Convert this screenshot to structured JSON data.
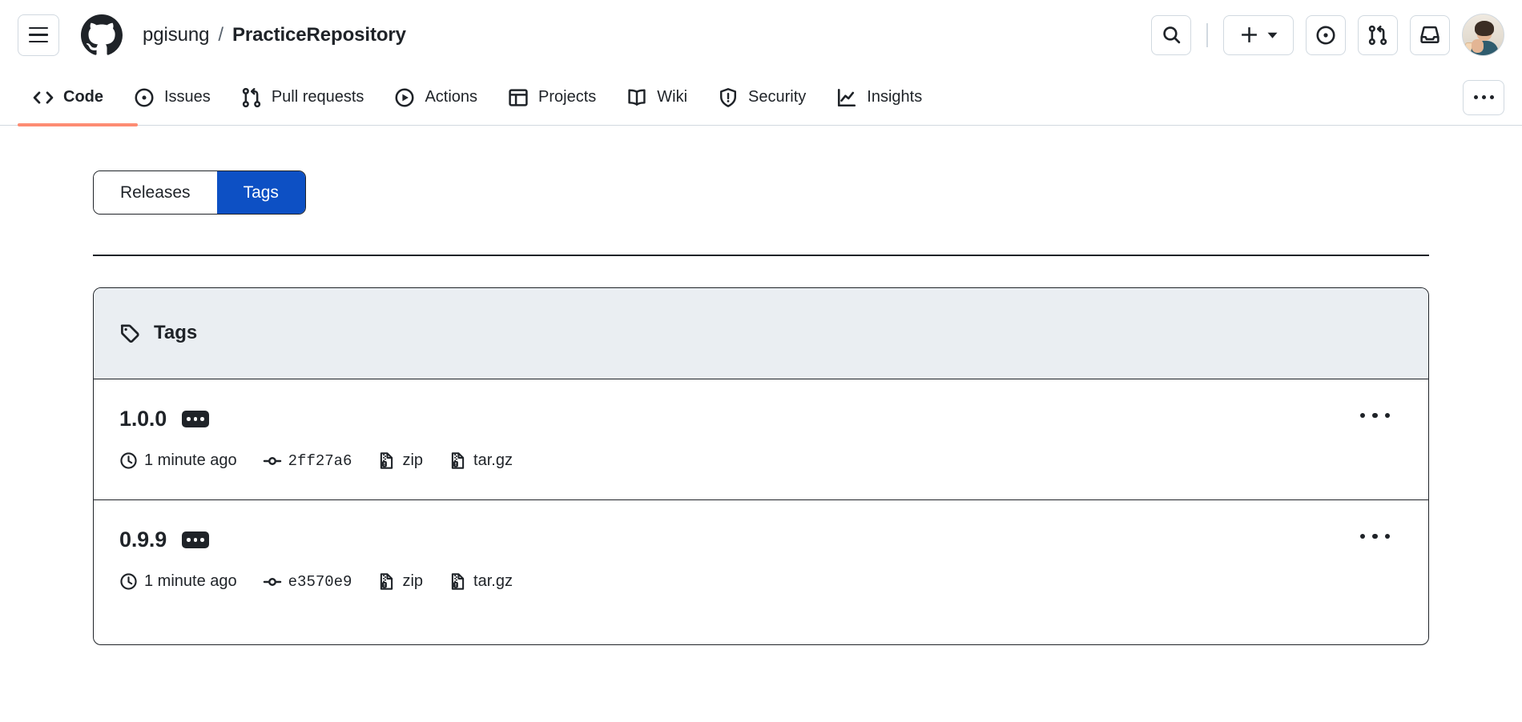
{
  "header": {
    "menu_button": "menu-icon",
    "logo": "github-logo",
    "repo_owner": "pgisung",
    "separator": "/",
    "repo_name": "PracticeRepository",
    "actions": [
      {
        "name": "search-button",
        "icon": "search-icon"
      },
      {
        "name": "create-new-button",
        "icon": "plus-icon",
        "caret": "chevron-down-icon"
      },
      {
        "name": "issues-button",
        "icon": "issue-opened-icon"
      },
      {
        "name": "pull-requests-button",
        "icon": "git-pull-request-icon"
      },
      {
        "name": "notifications-button",
        "icon": "inbox-icon"
      },
      {
        "name": "user-avatar",
        "icon": "avatar"
      }
    ]
  },
  "repo_nav": {
    "tabs": [
      {
        "label": "Code",
        "icon": "code-icon",
        "active": true
      },
      {
        "label": "Issues",
        "icon": "issue-opened-icon",
        "active": false
      },
      {
        "label": "Pull requests",
        "icon": "git-pull-request-icon",
        "active": false
      },
      {
        "label": "Actions",
        "icon": "play-icon",
        "active": false
      },
      {
        "label": "Projects",
        "icon": "table-icon",
        "active": false
      },
      {
        "label": "Wiki",
        "icon": "book-icon",
        "active": false
      },
      {
        "label": "Security",
        "icon": "shield-icon",
        "active": false
      },
      {
        "label": "Insights",
        "icon": "graph-icon",
        "active": false
      }
    ],
    "overflow_button": "kebab-horizontal-icon",
    "active_underline_color": "#fd8c73"
  },
  "main": {
    "segmented_control": {
      "options": [
        {
          "label": "Releases",
          "selected": false
        },
        {
          "label": "Tags",
          "selected": true
        }
      ],
      "selected_bg": "#0d50c4",
      "selected_fg": "#ffffff"
    },
    "tags_panel": {
      "header_icon": "tag-icon",
      "header_title": "Tags",
      "header_bg": "#eaeef2",
      "rows": [
        {
          "name": "1.0.0",
          "verified_badge": "verified-dots-badge",
          "time_icon": "clock-icon",
          "time": "1 minute ago",
          "commit_icon": "git-commit-icon",
          "commit": "2ff27a6",
          "downloads": [
            {
              "label": "zip",
              "icon": "file-zip-icon"
            },
            {
              "label": "tar.gz",
              "icon": "file-zip-icon"
            }
          ],
          "row_menu": "kebab-horizontal-icon"
        },
        {
          "name": "0.9.9",
          "verified_badge": "verified-dots-badge",
          "time_icon": "clock-icon",
          "time": "1 minute ago",
          "commit_icon": "git-commit-icon",
          "commit": "e3570e9",
          "downloads": [
            {
              "label": "zip",
              "icon": "file-zip-icon"
            },
            {
              "label": "tar.gz",
              "icon": "file-zip-icon"
            }
          ],
          "row_menu": "kebab-horizontal-icon"
        }
      ]
    }
  }
}
